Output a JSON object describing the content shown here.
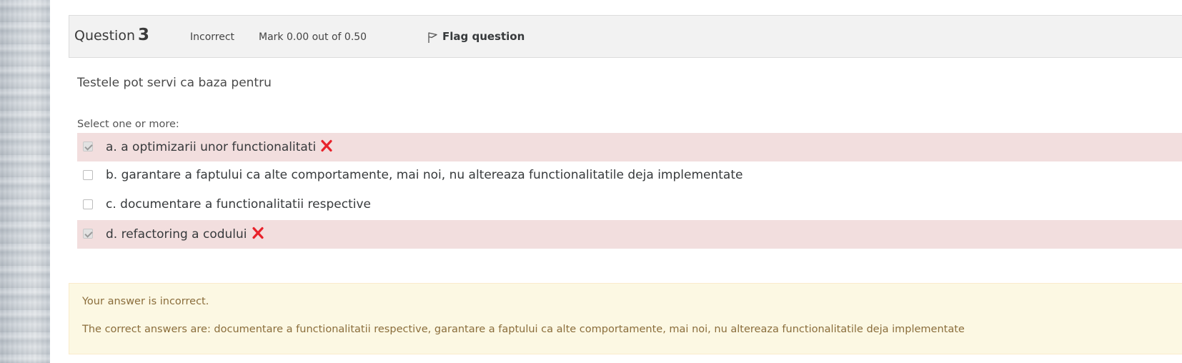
{
  "question": {
    "label": "Question",
    "number": "3",
    "state": "Incorrect",
    "grade": "Mark 0.00 out of 0.50",
    "flag_label": "Flag question",
    "text": "Testele pot servi ca baza pentru",
    "prompt": "Select one or more:"
  },
  "answers": [
    {
      "text": "a. a optimizarii unor functionalitati",
      "checked": true,
      "correct": false
    },
    {
      "text": "b. garantare a faptului ca alte comportamente, mai noi, nu altereaza functionalitatile deja implementate",
      "checked": false
    },
    {
      "text": "c. documentare a functionalitatii respective",
      "checked": false
    },
    {
      "text": "d. refactoring a codului",
      "checked": true,
      "correct": false
    }
  ],
  "feedback": {
    "general": "Your answer is incorrect.",
    "right_answer": "The correct answers are: documentare a functionalitatii respective, garantare a faptului ca alte comportamente, mai noi, nu altereaza functionalitatile deja implementate"
  },
  "colors": {
    "incorrect_bg": "#f2dede",
    "feedback_bg": "#fcf8e3",
    "feedback_text": "#8a6d3b",
    "x_mark": "#e8222b"
  },
  "icons": {
    "flag": "flag-icon",
    "incorrect": "incorrect-x-icon"
  }
}
